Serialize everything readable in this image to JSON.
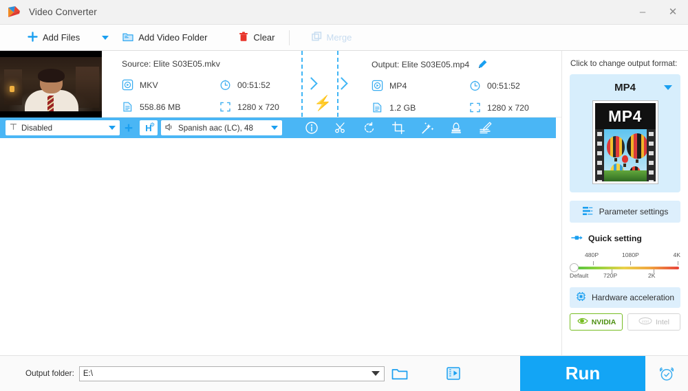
{
  "window": {
    "title": "Video Converter",
    "minimize_label": "–",
    "close_label": "✕"
  },
  "toolbar": {
    "add_files_label": "Add Files",
    "add_video_folder_label": "Add Video Folder",
    "clear_label": "Clear",
    "merge_label": "Merge"
  },
  "file_row": {
    "source_label": "Source: Elite S03E05.mkv",
    "source_format": "MKV",
    "source_duration": "00:51:52",
    "source_size": "558.86 MB",
    "source_resolution": "1280 x 720",
    "output_label": "Output: Elite S03E05.mp4",
    "output_format": "MP4",
    "output_duration": "00:51:52",
    "output_size": "1.2 GB",
    "output_resolution": "1280 x 720",
    "close_label": "✕"
  },
  "blue_bar": {
    "subtitle_value": "Disabled",
    "audio_value": "Spanish aac (LC), 48",
    "h_label": "H",
    "h_sup": "⚙",
    "plus_label": "+"
  },
  "sidebar": {
    "hint": "Click to change output format:",
    "format_name": "MP4",
    "format_thumb_label": "MP4",
    "parameter_settings_label": "Parameter settings",
    "quick_setting_label": "Quick setting",
    "slider": {
      "top_labels": [
        "480P",
        "1080P",
        "4K"
      ],
      "bottom_labels": [
        "Default",
        "720P",
        "2K"
      ],
      "value": "Default"
    },
    "hardware_acceleration_label": "Hardware acceleration",
    "gpu_nvidia_label": "NVIDIA",
    "gpu_intel_label": "Intel"
  },
  "bottom": {
    "output_folder_label": "Output folder:",
    "output_folder_value": "E:\\",
    "run_label": "Run"
  },
  "colors": {
    "accent_blue": "#13a5f5",
    "bar_blue": "#4ab6f5",
    "panel_blue": "#d7eefc",
    "bolt_orange": "#f97316",
    "nvidia_green": "#76bc21"
  }
}
